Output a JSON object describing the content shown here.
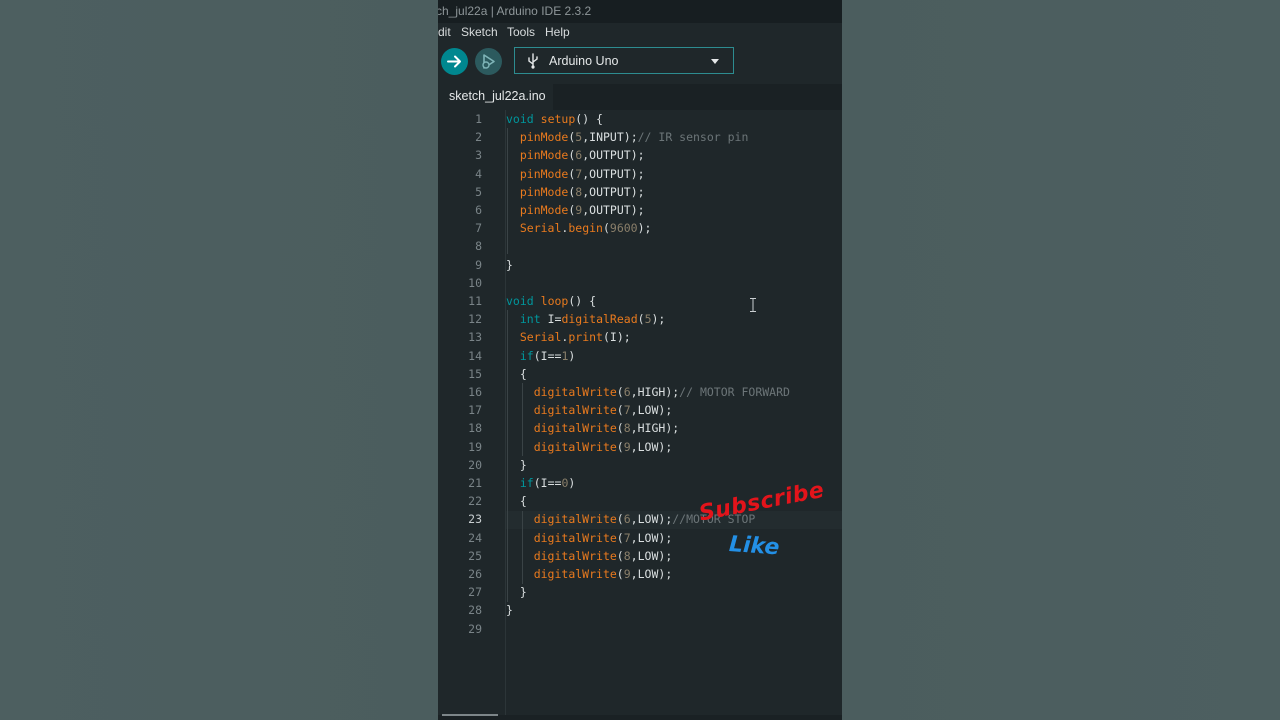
{
  "window": {
    "title": "ch_jul22a | Arduino IDE 2.3.2"
  },
  "menu": {
    "items": [
      "dit",
      "Sketch",
      "Tools",
      "Help"
    ]
  },
  "toolbar": {
    "verify_icon": "arrow-right-icon",
    "upload_icon": "debug-icon",
    "board": "Arduino Uno",
    "board_icon": "usb-icon",
    "board_dropdown_icon": "caret-down-icon"
  },
  "tabs": [
    {
      "label": "sketch_jul22a.ino",
      "active": true
    }
  ],
  "editor": {
    "active_line": 23,
    "lines": [
      {
        "n": "1",
        "code": "void setup() {"
      },
      {
        "n": "2",
        "code": "  pinMode(5,INPUT);// IR sensor pin"
      },
      {
        "n": "3",
        "code": "  pinMode(6,OUTPUT);"
      },
      {
        "n": "4",
        "code": "  pinMode(7,OUTPUT);"
      },
      {
        "n": "5",
        "code": "  pinMode(8,OUTPUT);"
      },
      {
        "n": "6",
        "code": "  pinMode(9,OUTPUT);"
      },
      {
        "n": "7",
        "code": "  Serial.begin(9600);"
      },
      {
        "n": "8",
        "code": ""
      },
      {
        "n": "9",
        "code": "}"
      },
      {
        "n": "10",
        "code": ""
      },
      {
        "n": "11",
        "code": "void loop() {"
      },
      {
        "n": "12",
        "code": "  int I=digitalRead(5);"
      },
      {
        "n": "13",
        "code": "  Serial.print(I);"
      },
      {
        "n": "14",
        "code": "  if(I==1)"
      },
      {
        "n": "15",
        "code": "  {"
      },
      {
        "n": "16",
        "code": "    digitalWrite(6,HIGH);// MOTOR FORWARD"
      },
      {
        "n": "17",
        "code": "    digitalWrite(7,LOW);"
      },
      {
        "n": "18",
        "code": "    digitalWrite(8,HIGH);"
      },
      {
        "n": "19",
        "code": "    digitalWrite(9,LOW);"
      },
      {
        "n": "20",
        "code": "  }"
      },
      {
        "n": "21",
        "code": "  if(I==0)"
      },
      {
        "n": "22",
        "code": "  {"
      },
      {
        "n": "23",
        "code": "    digitalWrite(6,LOW);//MOTOR STOP"
      },
      {
        "n": "24",
        "code": "    digitalWrite(7,LOW);"
      },
      {
        "n": "25",
        "code": "    digitalWrite(8,LOW);"
      },
      {
        "n": "26",
        "code": "    digitalWrite(9,LOW);"
      },
      {
        "n": "27",
        "code": "  }"
      },
      {
        "n": "28",
        "code": "}"
      },
      {
        "n": "29",
        "code": ""
      }
    ]
  },
  "overlay": {
    "subscribe": "Subscribe",
    "like": "Like"
  },
  "colors": {
    "accent": "#00878f",
    "keyword": "#00979d",
    "function": "#e97a1e",
    "number": "#8a7f6a",
    "comment": "#6c7578",
    "subscribe_red": "#e3141b",
    "like_blue": "#2390e6"
  }
}
